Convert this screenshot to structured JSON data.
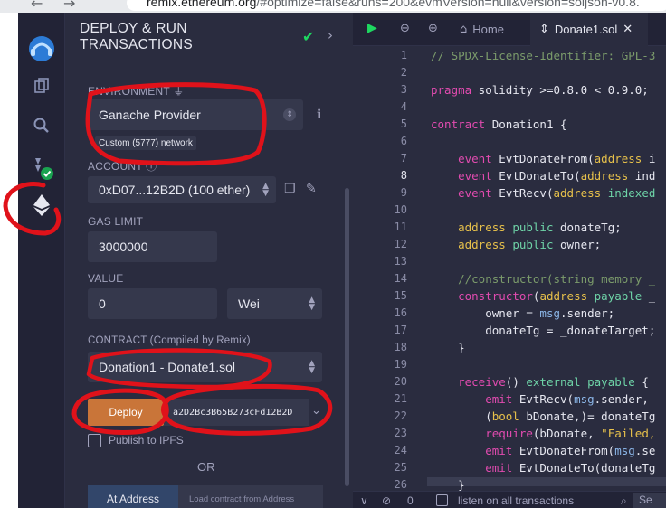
{
  "browser": {
    "back_icon": "arrow-left-icon",
    "forward_icon": "arrow-right-icon",
    "url_host": "remix.ethereum.org",
    "url_path": "/#optimize=false&runs=200&evmVersion=null&version=soljson-v0.8."
  },
  "rail": {
    "icons": [
      "remix-logo-icon",
      "files-icon",
      "search-icon",
      "solidity-compiler-icon",
      "deploy-run-icon"
    ]
  },
  "deploy_panel": {
    "title_line1": "DEPLOY & RUN",
    "title_line2": "TRANSACTIONS",
    "environment_label": "ENVIRONMENT",
    "environment_value": "Ganache Provider",
    "network_badge": "Custom (5777) network",
    "account_label": "ACCOUNT",
    "account_value": "0xD07...12B2D (100 ether)",
    "gas_limit_label": "GAS LIMIT",
    "gas_limit_value": "3000000",
    "value_label": "VALUE",
    "value_amount": "0",
    "value_unit": "Wei",
    "contract_label": "CONTRACT (Compiled by Remix)",
    "contract_value": "Donation1 - Donate1.sol",
    "deploy_button": "Deploy",
    "deploy_args": "a2D2Bc3B65B273cFd12B2D",
    "publish_ipfs": "Publish to IPFS",
    "or_text": "OR",
    "at_address_button": "At Address",
    "load_contract_placeholder": "Load contract from Address"
  },
  "editor": {
    "tabs": [
      {
        "label": "Home",
        "icon": "home-icon"
      },
      {
        "label": "Donate1.sol",
        "icon": "solidity-file-icon",
        "active": true
      }
    ],
    "line_numbers": [
      "1",
      "2",
      "3",
      "4",
      "5",
      "6",
      "7",
      "8",
      "9",
      "10",
      "11",
      "12",
      "13",
      "14",
      "15",
      "16",
      "17",
      "18",
      "19",
      "20",
      "21",
      "22",
      "23",
      "24",
      "25",
      "26"
    ],
    "lines": [
      "// SPDX-License-Identifier: GPL-3",
      "",
      "pragma solidity >=0.8.0 < 0.9.0;",
      "",
      "contract Donation1 {",
      "",
      "    event EvtDonateFrom(address i",
      "    event EvtDonateTo(address ind",
      "    event EvtRecv(address indexed",
      "",
      "    address public donateTg;",
      "    address public owner;",
      "",
      "    //constructor(string memory _",
      "    constructor(address payable _",
      "        owner = msg.sender;",
      "        donateTg = _donateTarget;",
      "    }",
      "",
      "    receive() external payable {",
      "        emit EvtRecv(msg.sender,",
      "        (bool bDonate,)= donateTg",
      "        require(bDonate, \"Failed,",
      "        emit EvtDonateFrom(msg.se",
      "        emit EvtDonateTo(donateTg",
      "    }"
    ]
  },
  "terminal": {
    "count": "0",
    "listen_label": "listen on all transactions",
    "search_text": "Se"
  },
  "colors": {
    "accent_green": "#1ed760",
    "deploy_orange": "#c97539",
    "annotation_red": "#e0121a"
  }
}
